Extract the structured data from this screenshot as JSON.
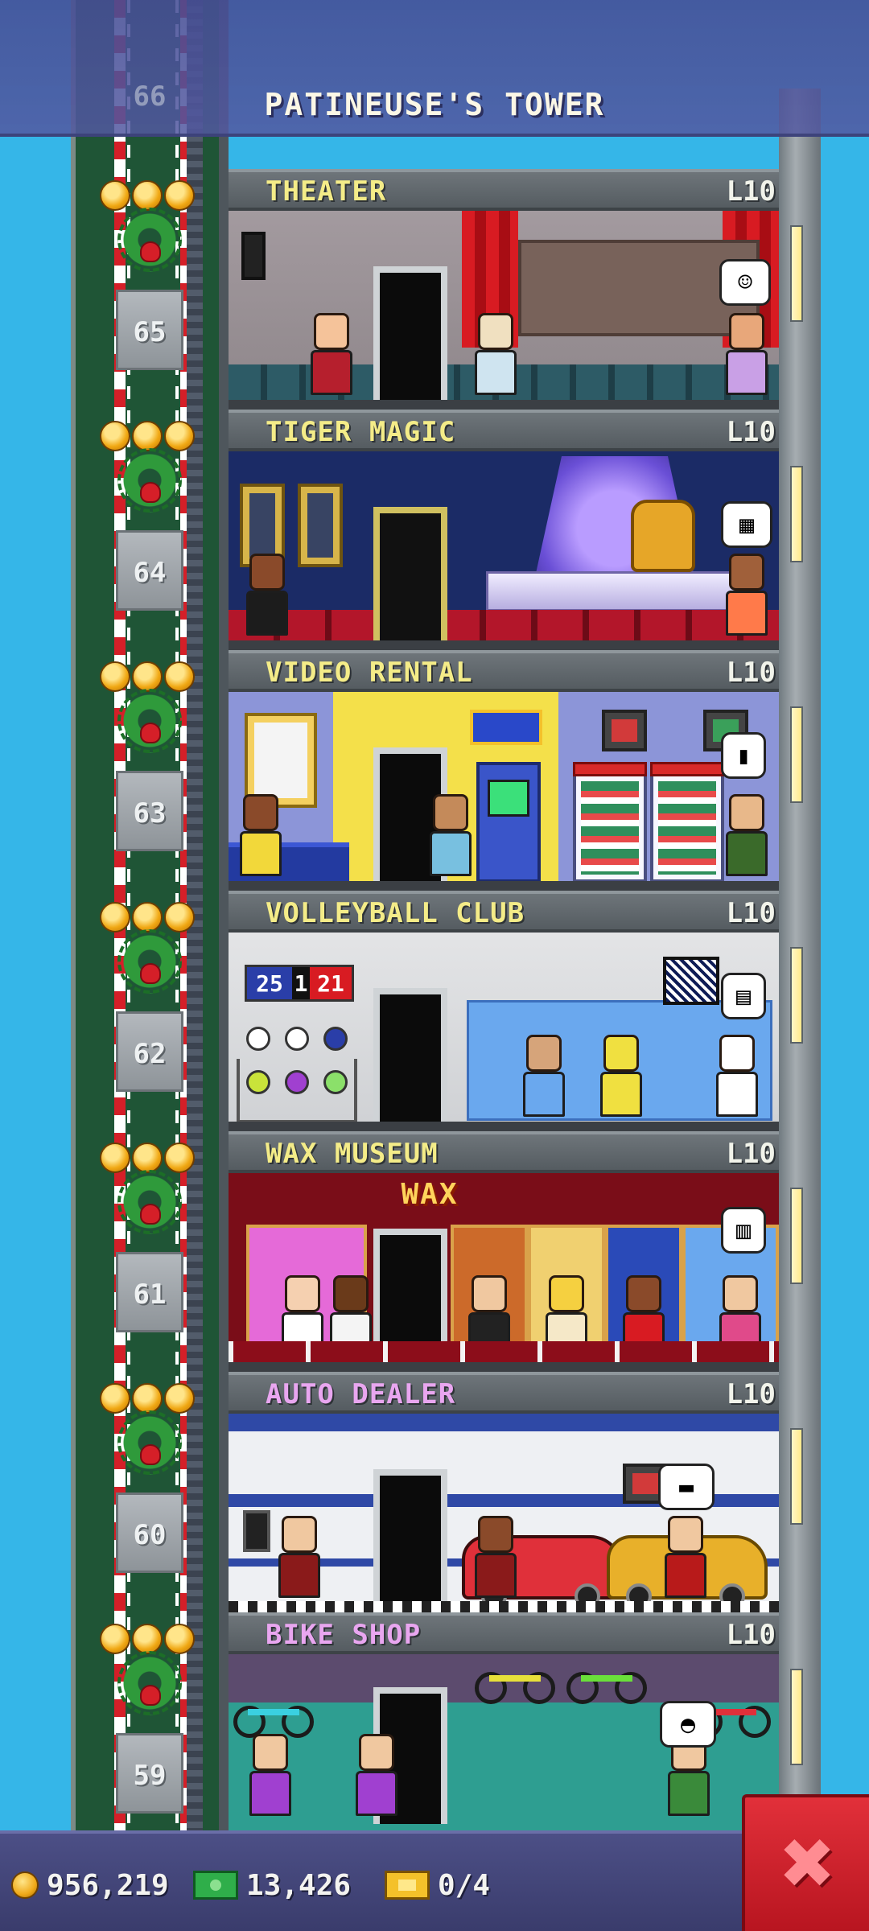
{
  "tower_title": "PATINEUSE'S TOWER",
  "top_floor_number": "66",
  "floors": [
    {
      "name": "THEATER",
      "level": "L10",
      "number": "65",
      "color": "#f4ec88"
    },
    {
      "name": "TIGER MAGIC",
      "level": "L10",
      "number": "64",
      "color": "#f4ec88"
    },
    {
      "name": "VIDEO RENTAL",
      "level": "L10",
      "number": "63",
      "color": "#f4ec88"
    },
    {
      "name": "VOLLEYBALL CLUB",
      "level": "L10",
      "number": "62",
      "color": "#f4ec88"
    },
    {
      "name": "WAX MUSEUM",
      "level": "L10",
      "number": "61",
      "color": "#f4ec88"
    },
    {
      "name": "AUTO DEALER",
      "level": "L10",
      "number": "60",
      "color": "#e9a6f0"
    },
    {
      "name": "BIKE SHOP",
      "level": "L10",
      "number": "59",
      "color": "#e9a6f0"
    }
  ],
  "volleyball_score": {
    "left": "25",
    "middle": "1",
    "right": "21"
  },
  "wax_sign": "WAX",
  "hud": {
    "coins": "956,219",
    "bux": "13,426",
    "tickets": "0/4",
    "coin_icon": "coin-icon",
    "bux_icon": "bux-icon",
    "ticket_icon": "golden-ticket-icon"
  },
  "close_label": "✖",
  "colors": {
    "sky": "#35b6e8",
    "hud": "#3a3c6c",
    "close": "#d22430"
  }
}
